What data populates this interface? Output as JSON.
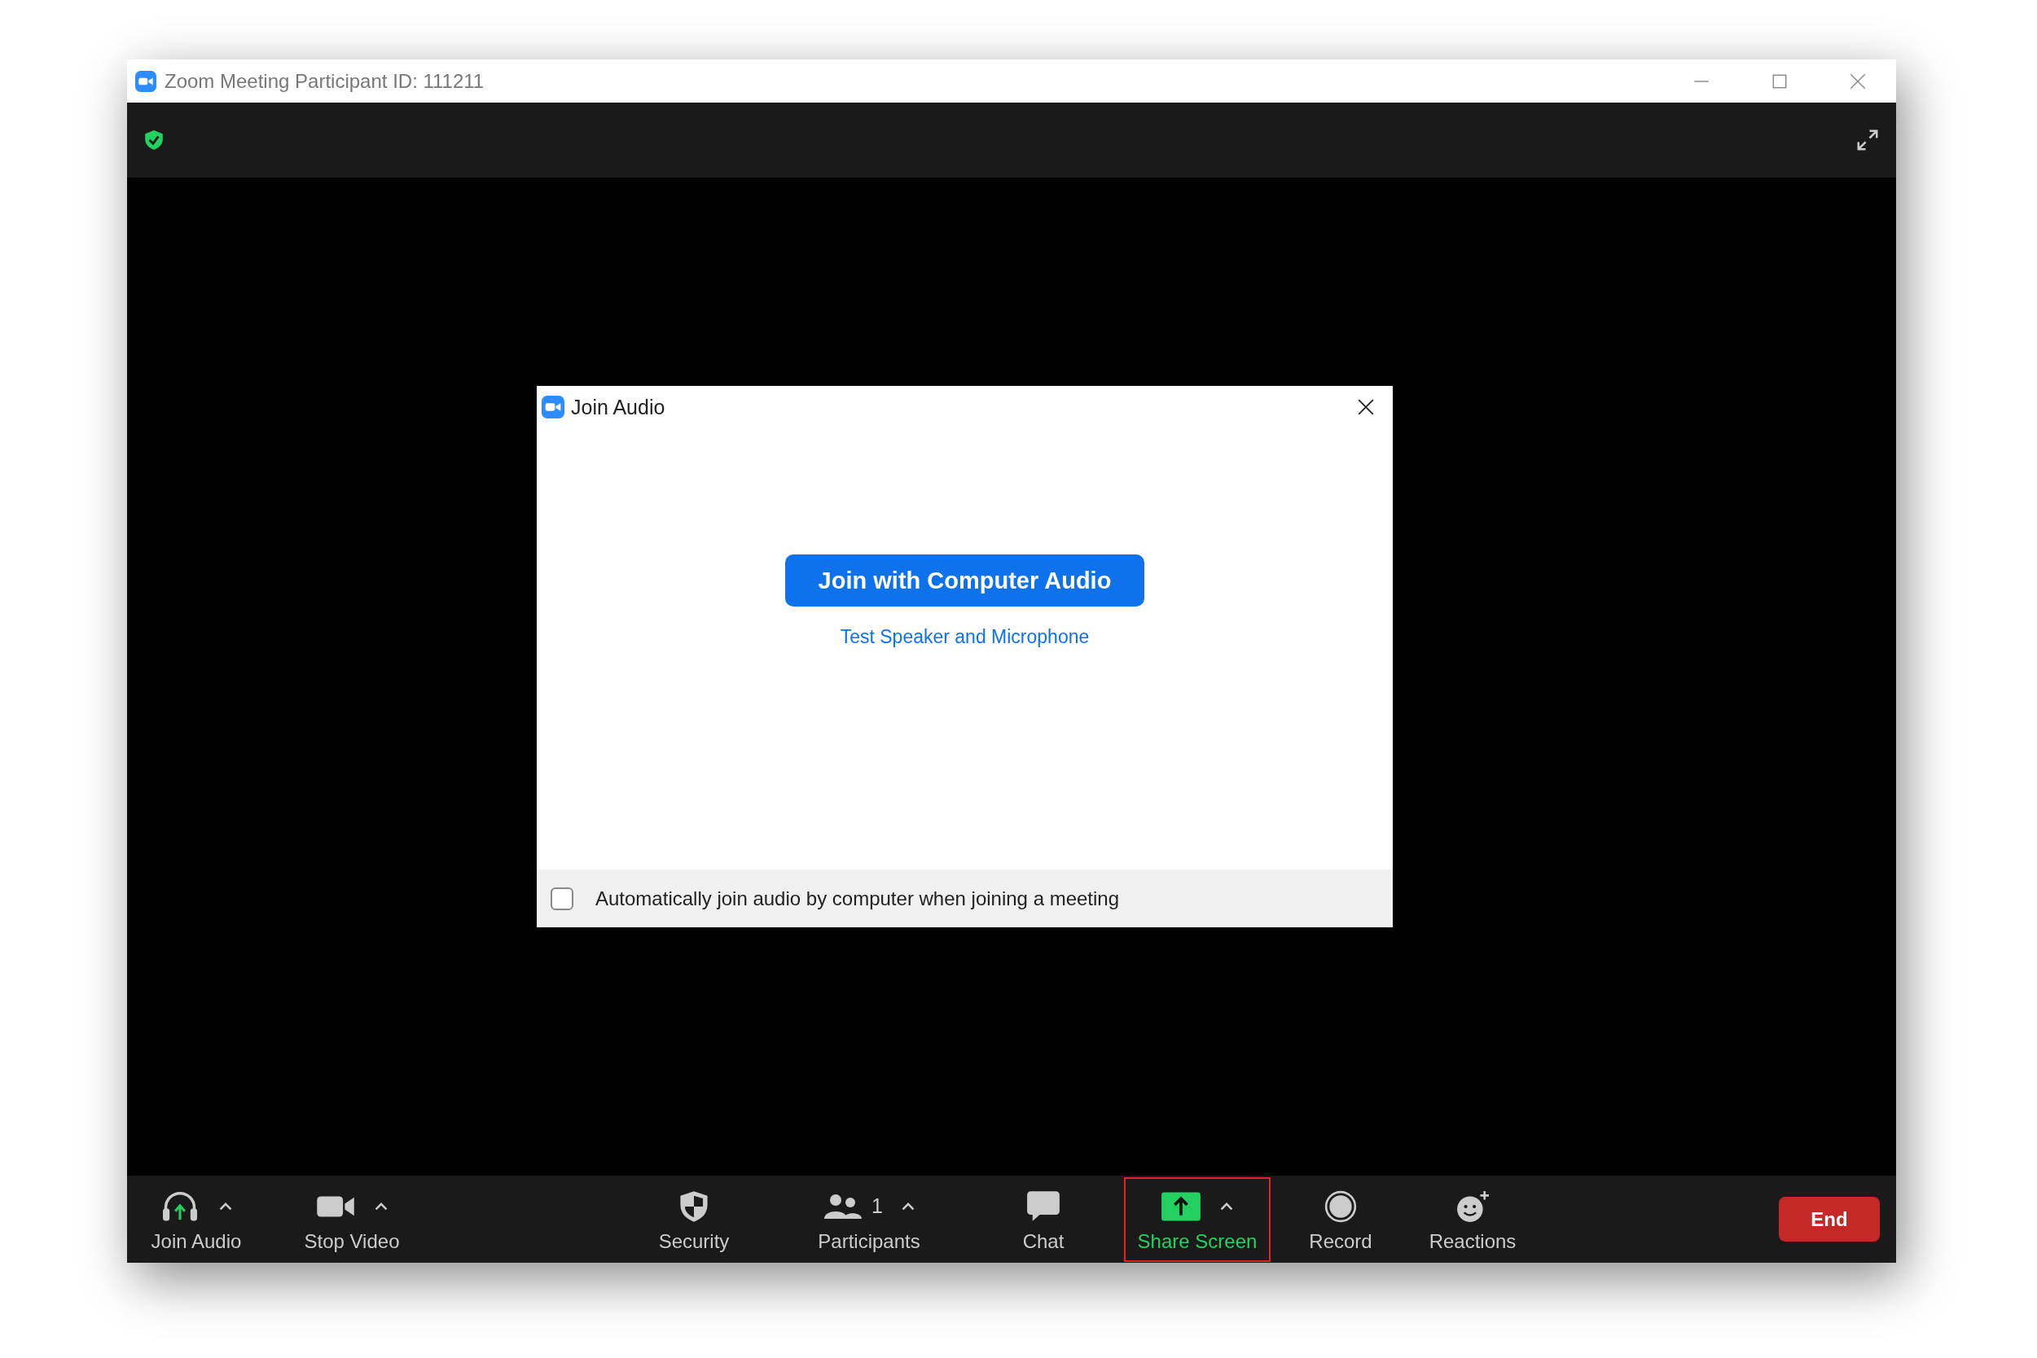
{
  "window": {
    "title": "Zoom Meeting Participant ID: 111211"
  },
  "dialog": {
    "title": "Join Audio",
    "primary_button": "Join with Computer Audio",
    "link": "Test Speaker and Microphone",
    "checkbox": {
      "label": "Automatically join audio by computer when joining a meeting",
      "checked": false
    }
  },
  "toolbar": {
    "left": [
      {
        "kind": "audio",
        "label": "Join Audio",
        "menu": true,
        "highlighted": false
      },
      {
        "kind": "video",
        "label": "Stop Video",
        "menu": true,
        "highlighted": false
      }
    ],
    "center": [
      {
        "kind": "security",
        "label": "Security",
        "menu": false,
        "highlighted": false
      },
      {
        "kind": "participants",
        "label": "Participants",
        "count": "1",
        "menu": true,
        "highlighted": false
      },
      {
        "kind": "chat",
        "label": "Chat",
        "menu": false,
        "highlighted": false
      },
      {
        "kind": "share",
        "label": "Share Screen",
        "menu": true,
        "highlighted": true
      },
      {
        "kind": "record",
        "label": "Record",
        "menu": false,
        "highlighted": false
      },
      {
        "kind": "reactions",
        "label": "Reactions",
        "menu": false,
        "highlighted": false
      }
    ],
    "end_button": "End"
  }
}
